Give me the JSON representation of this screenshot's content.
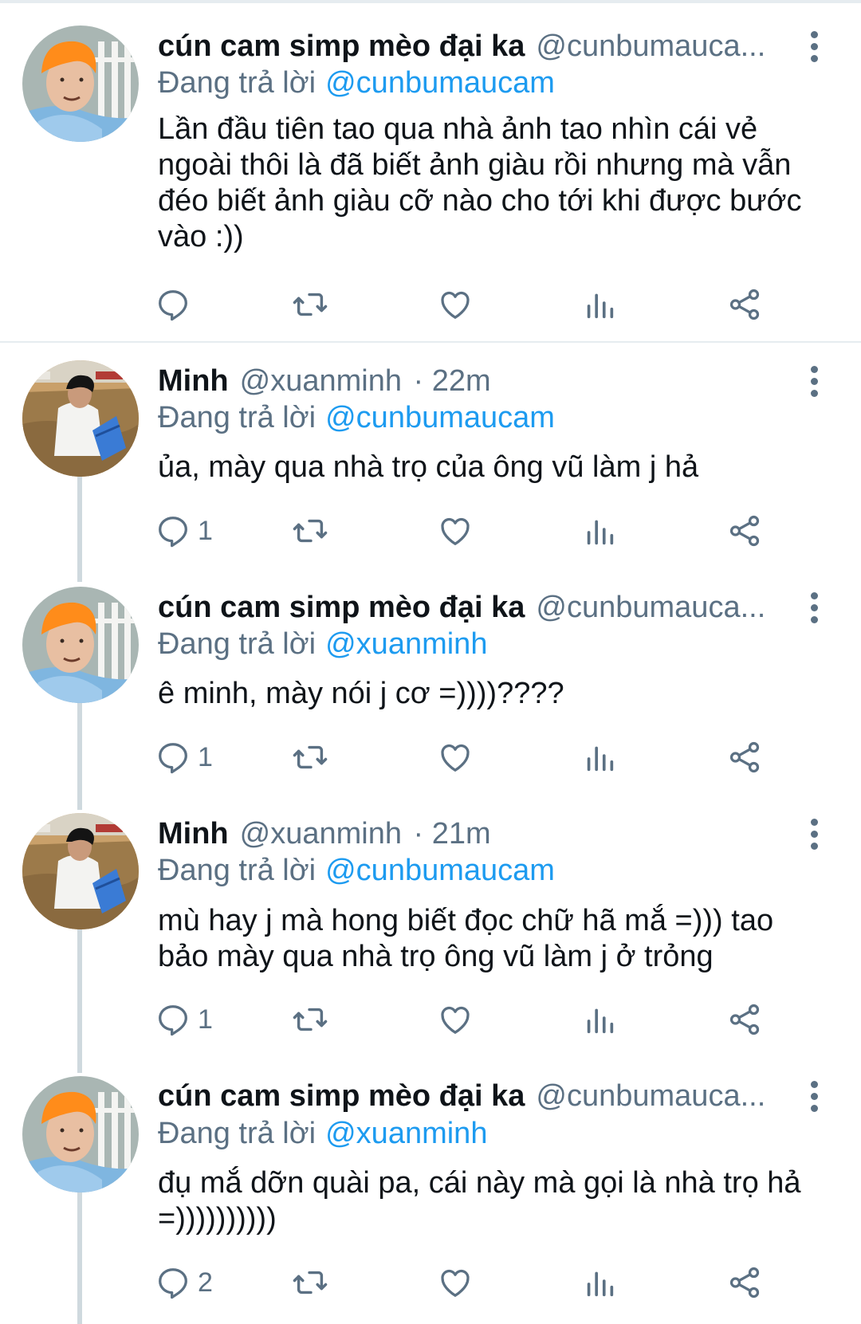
{
  "tweets": [
    {
      "name": "cún cam simp mèo đại ka",
      "handle": "@cunbumauca...",
      "time": "",
      "replying_prefix": "Đang trả lời",
      "replying_to": "@cunbumaucam",
      "text": "Lần đầu tiên tao qua nhà ảnh tao nhìn cái vẻ ngoài thôi là đã biết ảnh giàu rồi nhưng mà vẫn đéo biết ảnh giàu cỡ nào cho tới khi được bước vào :))",
      "reply_count": "",
      "avatar": "orange-hair-avatar"
    },
    {
      "name": "Minh",
      "handle": "@xuanminh",
      "time": "· 22m",
      "replying_prefix": "Đang trả lời",
      "replying_to": "@cunbumaucam",
      "text": "ủa, mày qua nhà trọ của ông vũ làm j hả",
      "reply_count": "1",
      "avatar": "field-photo-avatar"
    },
    {
      "name": "cún cam simp mèo đại ka",
      "handle": "@cunbumauca...",
      "time": "",
      "replying_prefix": "Đang trả lời",
      "replying_to": "@xuanminh",
      "text": "ê minh, mày nói j cơ =))))????",
      "reply_count": "1",
      "avatar": "orange-hair-avatar"
    },
    {
      "name": "Minh",
      "handle": "@xuanminh",
      "time": "· 21m",
      "replying_prefix": "Đang trả lời",
      "replying_to": "@cunbumaucam",
      "text": "mù hay j mà hong biết đọc chữ hã mắ =))) tao bảo mày qua nhà trọ ông vũ làm j ở trỏng",
      "reply_count": "1",
      "avatar": "field-photo-avatar"
    },
    {
      "name": "cún cam simp mèo đại ka",
      "handle": "@cunbumauca...",
      "time": "",
      "replying_prefix": "Đang trả lời",
      "replying_to": "@xuanminh",
      "text": "đụ mắ dỡn quài pa, cái này mà gọi là nhà trọ hả =))))))))))",
      "reply_count": "2",
      "avatar": "orange-hair-avatar"
    }
  ],
  "icons": {
    "reply": "reply-icon",
    "retweet": "retweet-icon",
    "like": "heart-icon",
    "analytics": "analytics-icon",
    "share": "share-icon",
    "more": "more-vertical-icon"
  },
  "colors": {
    "text": "#0f1419",
    "secondary": "#5b7083",
    "mention": "#1d9bf0",
    "divider": "#e6ecf0",
    "thread_line": "#cfd9de"
  }
}
